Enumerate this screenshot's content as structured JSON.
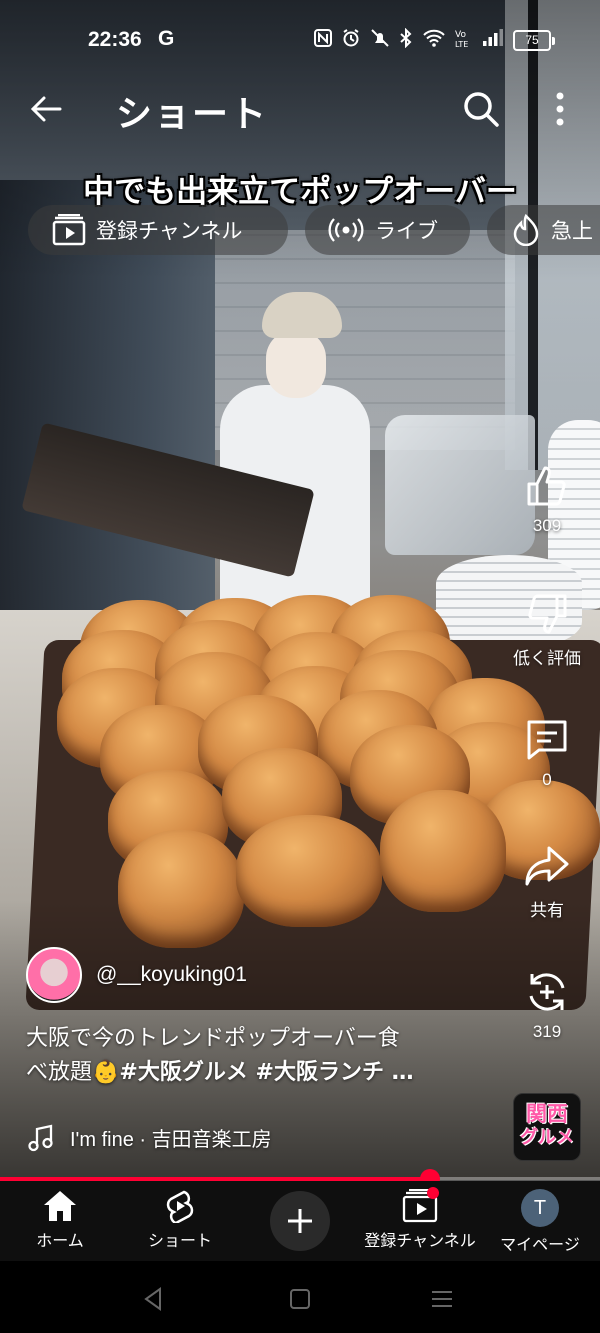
{
  "status_bar": {
    "time": "22:36",
    "google_indicator": "G",
    "battery_level": "75"
  },
  "header": {
    "title": "ショート"
  },
  "video_caption": "中でも出来立てポップオーバー",
  "chips": [
    {
      "label": "登録チャンネル",
      "icon": "subscriptions-icon"
    },
    {
      "label": "ライブ",
      "icon": "live-icon"
    },
    {
      "label": "急上",
      "icon": "trending-icon"
    }
  ],
  "actions": {
    "like_count": "309",
    "dislike_label": "低く評価",
    "comment_count": "0",
    "share_label": "共有",
    "remix_count": "319"
  },
  "channel": {
    "handle": "@__koyuking01"
  },
  "description": {
    "line1": "大阪で今のトレンドポップオーバー食",
    "line2_text": "べ放題",
    "emoji": "👶",
    "tags": "#大阪グルメ #大阪ランチ …"
  },
  "music": {
    "track": "I'm fine · 吉田音楽工房"
  },
  "badge": {
    "line1": "関西",
    "line2": "グルメ"
  },
  "progress": {
    "fraction": 0.716
  },
  "bottom_nav": {
    "home": "ホーム",
    "shorts": "ショート",
    "subscriptions": "登録チャンネル",
    "mypage": "マイページ",
    "avatar_letter": "T"
  },
  "colors": {
    "accent": "#ff0033",
    "nav_background": "#0f0f0f"
  }
}
